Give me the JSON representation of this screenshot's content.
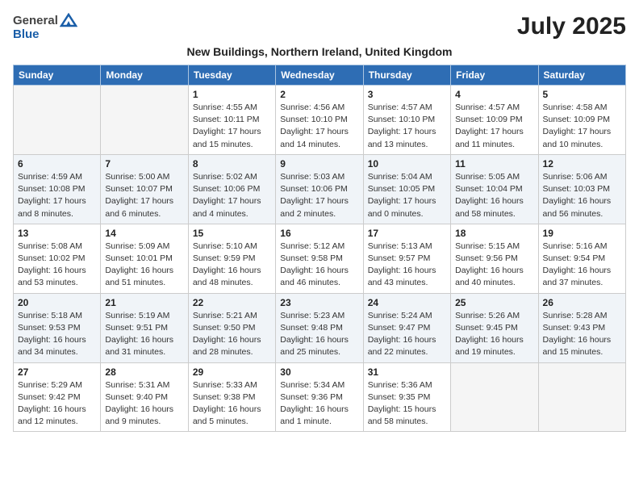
{
  "header": {
    "logo_general": "General",
    "logo_blue": "Blue",
    "title": "July 2025",
    "location": "New Buildings, Northern Ireland, United Kingdom"
  },
  "columns": [
    "Sunday",
    "Monday",
    "Tuesday",
    "Wednesday",
    "Thursday",
    "Friday",
    "Saturday"
  ],
  "weeks": [
    [
      {
        "day": "",
        "detail": ""
      },
      {
        "day": "",
        "detail": ""
      },
      {
        "day": "1",
        "detail": "Sunrise: 4:55 AM\nSunset: 10:11 PM\nDaylight: 17 hours\nand 15 minutes."
      },
      {
        "day": "2",
        "detail": "Sunrise: 4:56 AM\nSunset: 10:10 PM\nDaylight: 17 hours\nand 14 minutes."
      },
      {
        "day": "3",
        "detail": "Sunrise: 4:57 AM\nSunset: 10:10 PM\nDaylight: 17 hours\nand 13 minutes."
      },
      {
        "day": "4",
        "detail": "Sunrise: 4:57 AM\nSunset: 10:09 PM\nDaylight: 17 hours\nand 11 minutes."
      },
      {
        "day": "5",
        "detail": "Sunrise: 4:58 AM\nSunset: 10:09 PM\nDaylight: 17 hours\nand 10 minutes."
      }
    ],
    [
      {
        "day": "6",
        "detail": "Sunrise: 4:59 AM\nSunset: 10:08 PM\nDaylight: 17 hours\nand 8 minutes."
      },
      {
        "day": "7",
        "detail": "Sunrise: 5:00 AM\nSunset: 10:07 PM\nDaylight: 17 hours\nand 6 minutes."
      },
      {
        "day": "8",
        "detail": "Sunrise: 5:02 AM\nSunset: 10:06 PM\nDaylight: 17 hours\nand 4 minutes."
      },
      {
        "day": "9",
        "detail": "Sunrise: 5:03 AM\nSunset: 10:06 PM\nDaylight: 17 hours\nand 2 minutes."
      },
      {
        "day": "10",
        "detail": "Sunrise: 5:04 AM\nSunset: 10:05 PM\nDaylight: 17 hours\nand 0 minutes."
      },
      {
        "day": "11",
        "detail": "Sunrise: 5:05 AM\nSunset: 10:04 PM\nDaylight: 16 hours\nand 58 minutes."
      },
      {
        "day": "12",
        "detail": "Sunrise: 5:06 AM\nSunset: 10:03 PM\nDaylight: 16 hours\nand 56 minutes."
      }
    ],
    [
      {
        "day": "13",
        "detail": "Sunrise: 5:08 AM\nSunset: 10:02 PM\nDaylight: 16 hours\nand 53 minutes."
      },
      {
        "day": "14",
        "detail": "Sunrise: 5:09 AM\nSunset: 10:01 PM\nDaylight: 16 hours\nand 51 minutes."
      },
      {
        "day": "15",
        "detail": "Sunrise: 5:10 AM\nSunset: 9:59 PM\nDaylight: 16 hours\nand 48 minutes."
      },
      {
        "day": "16",
        "detail": "Sunrise: 5:12 AM\nSunset: 9:58 PM\nDaylight: 16 hours\nand 46 minutes."
      },
      {
        "day": "17",
        "detail": "Sunrise: 5:13 AM\nSunset: 9:57 PM\nDaylight: 16 hours\nand 43 minutes."
      },
      {
        "day": "18",
        "detail": "Sunrise: 5:15 AM\nSunset: 9:56 PM\nDaylight: 16 hours\nand 40 minutes."
      },
      {
        "day": "19",
        "detail": "Sunrise: 5:16 AM\nSunset: 9:54 PM\nDaylight: 16 hours\nand 37 minutes."
      }
    ],
    [
      {
        "day": "20",
        "detail": "Sunrise: 5:18 AM\nSunset: 9:53 PM\nDaylight: 16 hours\nand 34 minutes."
      },
      {
        "day": "21",
        "detail": "Sunrise: 5:19 AM\nSunset: 9:51 PM\nDaylight: 16 hours\nand 31 minutes."
      },
      {
        "day": "22",
        "detail": "Sunrise: 5:21 AM\nSunset: 9:50 PM\nDaylight: 16 hours\nand 28 minutes."
      },
      {
        "day": "23",
        "detail": "Sunrise: 5:23 AM\nSunset: 9:48 PM\nDaylight: 16 hours\nand 25 minutes."
      },
      {
        "day": "24",
        "detail": "Sunrise: 5:24 AM\nSunset: 9:47 PM\nDaylight: 16 hours\nand 22 minutes."
      },
      {
        "day": "25",
        "detail": "Sunrise: 5:26 AM\nSunset: 9:45 PM\nDaylight: 16 hours\nand 19 minutes."
      },
      {
        "day": "26",
        "detail": "Sunrise: 5:28 AM\nSunset: 9:43 PM\nDaylight: 16 hours\nand 15 minutes."
      }
    ],
    [
      {
        "day": "27",
        "detail": "Sunrise: 5:29 AM\nSunset: 9:42 PM\nDaylight: 16 hours\nand 12 minutes."
      },
      {
        "day": "28",
        "detail": "Sunrise: 5:31 AM\nSunset: 9:40 PM\nDaylight: 16 hours\nand 9 minutes."
      },
      {
        "day": "29",
        "detail": "Sunrise: 5:33 AM\nSunset: 9:38 PM\nDaylight: 16 hours\nand 5 minutes."
      },
      {
        "day": "30",
        "detail": "Sunrise: 5:34 AM\nSunset: 9:36 PM\nDaylight: 16 hours\nand 1 minute."
      },
      {
        "day": "31",
        "detail": "Sunrise: 5:36 AM\nSunset: 9:35 PM\nDaylight: 15 hours\nand 58 minutes."
      },
      {
        "day": "",
        "detail": ""
      },
      {
        "day": "",
        "detail": ""
      }
    ]
  ]
}
